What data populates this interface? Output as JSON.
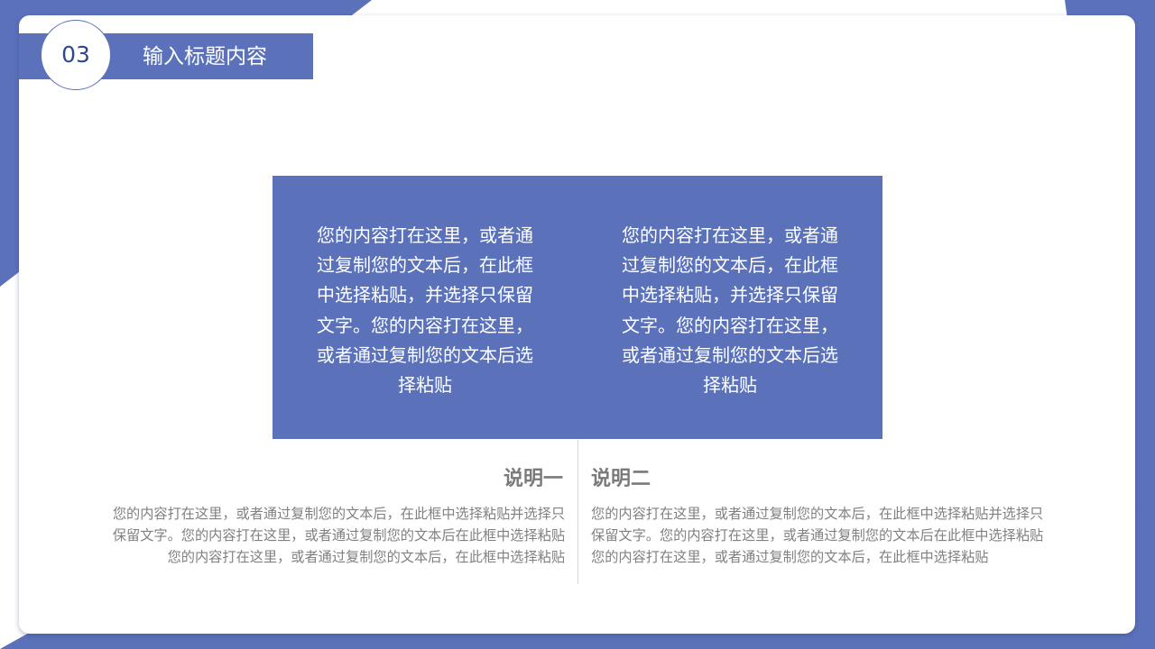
{
  "slide": {
    "number": "03",
    "title": "输入标题内容"
  },
  "colors": {
    "accent": "#5b72bb",
    "number_text": "#2f4791",
    "gray_text": "#808080",
    "subtitle_text": "#7a7a7a"
  },
  "box": {
    "left_text": "您的内容打在这里，或者通过复制您的文本后，在此框中选择粘贴，并选择只保留文字。您的内容打在这里，或者通过复制您的文本后选择粘贴",
    "right_text": "您的内容打在这里，或者通过复制您的文本后，在此框中选择粘贴，并选择只保留文字。您的内容打在这里，或者通过复制您的文本后选择粘贴"
  },
  "left": {
    "title": "说明一",
    "lines": [
      "您的内容打在这里，或者通过复制您的文本后，在此框中选择粘贴并选择只",
      "保留文字。您的内容打在这里，或者通过复制您的文本后在此框中选择粘贴",
      "您的内容打在这里，或者通过复制您的文本后，在此框中选择粘贴"
    ]
  },
  "right": {
    "title": "说明二",
    "lines": [
      "您的内容打在这里，或者通过复制您的文本后，在此框中选择粘贴并选择只",
      "保留文字。您的内容打在这里，或者通过复制您的文本后在此框中选择粘贴",
      "您的内容打在这里，或者通过复制您的文本后，在此框中选择粘贴"
    ]
  }
}
